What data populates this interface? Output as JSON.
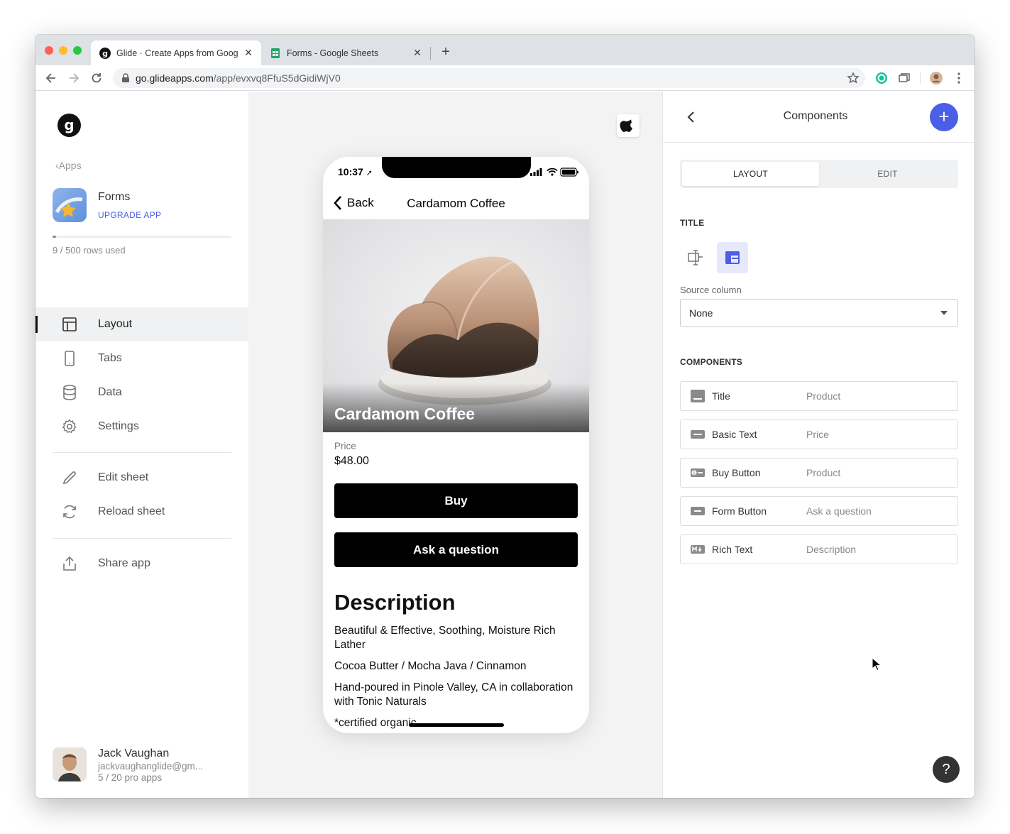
{
  "browser": {
    "tabs": [
      {
        "title": "Glide · Create Apps from Goog",
        "close": "✕",
        "active": true
      },
      {
        "title": "Forms - Google Sheets",
        "close": "✕",
        "active": false
      }
    ],
    "new_tab": "+",
    "url_host": "go.glideapps.com",
    "url_path": "/app/evxvq8FfuS5dGidiWjV0"
  },
  "sidebar": {
    "logo": "g",
    "apps_link": "Apps",
    "app_name": "Forms",
    "upgrade_label": "UPGRADE APP",
    "rows_used": "9 / 500 rows used",
    "rows_fraction": 0.018,
    "nav": [
      {
        "label": "Layout",
        "icon": "layout-icon",
        "active": true
      },
      {
        "label": "Tabs",
        "icon": "phone-icon",
        "active": false
      },
      {
        "label": "Data",
        "icon": "database-icon",
        "active": false
      },
      {
        "label": "Settings",
        "icon": "gear-icon",
        "active": false
      }
    ],
    "sheet_actions": [
      {
        "label": "Edit sheet",
        "icon": "pencil-icon"
      },
      {
        "label": "Reload sheet",
        "icon": "reload-icon"
      }
    ],
    "share": {
      "label": "Share app",
      "icon": "share-icon"
    },
    "user": {
      "name": "Jack Vaughan",
      "email": "jackvaughanglide@gm...",
      "plan": "5 / 20 pro apps"
    }
  },
  "phone": {
    "time": "10:37",
    "back_label": "Back",
    "nav_title": "Cardamom Coffee",
    "hero_title": "Cardamom Coffee",
    "price_label": "Price",
    "price_value": "$48.00",
    "buy_label": "Buy",
    "ask_label": "Ask a question",
    "description_heading": "Description",
    "description_lines": [
      "Beautiful & Effective, Soothing, Moisture Rich Lather",
      "Cocoa Butter / Mocha Java / Cinnamon",
      "Hand-poured in Pinole Valley, CA in collaboration with Tonic Naturals",
      "*certified organic"
    ]
  },
  "panel": {
    "title": "Components",
    "add": "+",
    "tabs": {
      "layout": "LAYOUT",
      "edit": "EDIT"
    },
    "title_section": "TITLE",
    "source_column_label": "Source column",
    "source_column_value": "None",
    "components_section": "COMPONENTS",
    "components": [
      {
        "name": "Title",
        "source": "Product",
        "icon": "title-component-icon"
      },
      {
        "name": "Basic Text",
        "source": "Price",
        "icon": "basic-text-icon"
      },
      {
        "name": "Buy Button",
        "source": "Product",
        "icon": "buy-button-icon"
      },
      {
        "name": "Form Button",
        "source": "Ask a question",
        "icon": "form-button-icon"
      },
      {
        "name": "Rich Text",
        "source": "Description",
        "icon": "rich-text-icon"
      }
    ],
    "help": "?"
  },
  "colors": {
    "accent": "#4b5ee8",
    "sidebar_active_bg": "#f0f1f2",
    "preview_bg": "#f3f3f3",
    "button_black": "#000000"
  }
}
